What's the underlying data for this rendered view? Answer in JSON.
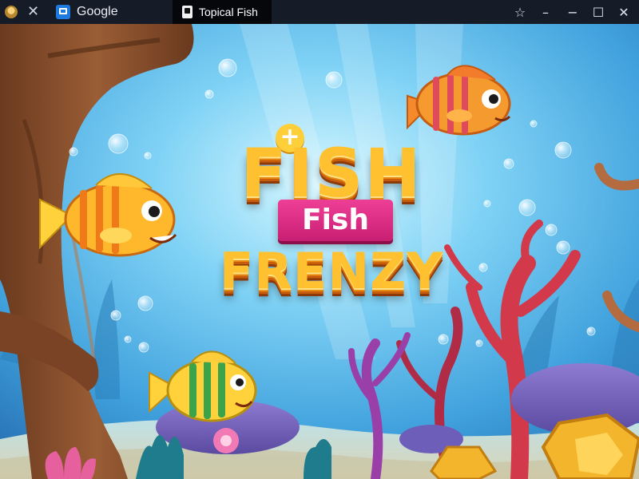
{
  "browser": {
    "tabs": [
      {
        "label": "Google",
        "favicon": "google-tab-icon"
      },
      {
        "label": "Topical Fish",
        "favicon": "page-tab-icon",
        "active": true
      }
    ],
    "controls": {
      "bookmark_icon": "☆",
      "minimize_icon": "–",
      "restore_icon": "☐",
      "close_icon": "✕"
    },
    "close_tab_icon": "✕"
  },
  "game": {
    "title_line1": "FISH",
    "title_banner": "Fish",
    "title_line2": "FRENZY",
    "title_plus": "+"
  },
  "colors": {
    "titlebar": "#161c27",
    "active_tab": "#05070b",
    "water_top": "#54b9ea",
    "water_mid": "#2d8ccd",
    "logo_yellow": "#ffc12f",
    "banner_pink": "#e23489"
  }
}
